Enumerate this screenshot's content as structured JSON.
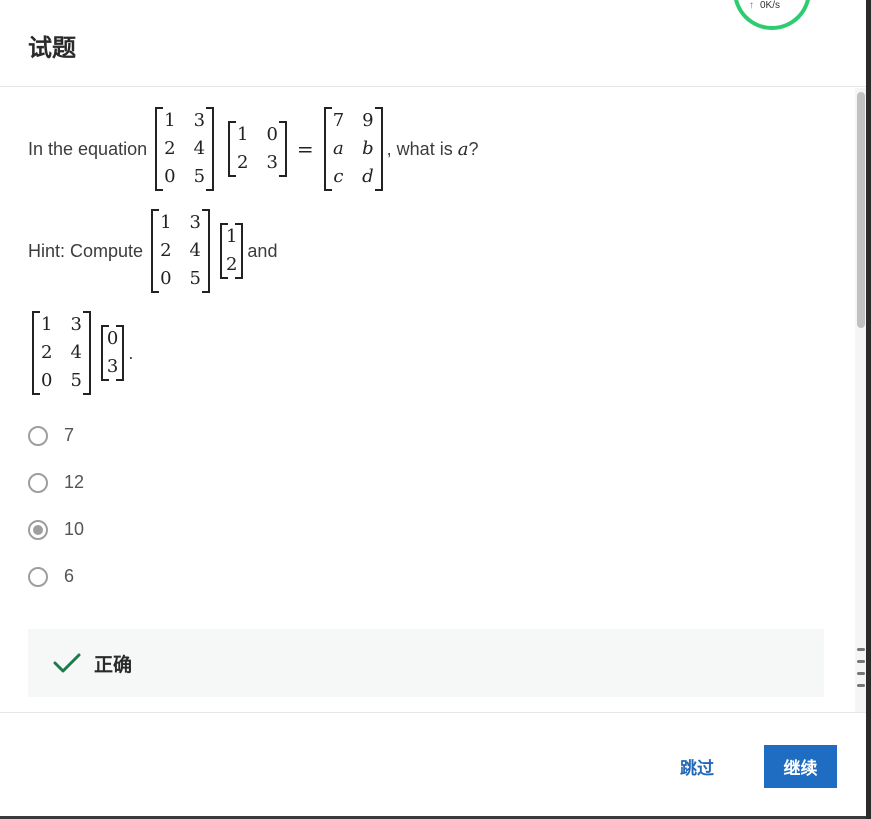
{
  "header": {
    "title": "试题"
  },
  "speed_widget": {
    "text": "0K/s"
  },
  "question": {
    "prefix": "In the equation",
    "suffix_before_var": ", what is ",
    "variable": "a",
    "suffix_after_var": "?",
    "matrix_a": [
      [
        "1",
        "3"
      ],
      [
        "2",
        "4"
      ],
      [
        "0",
        "5"
      ]
    ],
    "matrix_b": [
      [
        "1",
        "0"
      ],
      [
        "2",
        "3"
      ]
    ],
    "matrix_result": [
      [
        "7",
        "9"
      ],
      [
        "a",
        "b"
      ],
      [
        "c",
        "d"
      ]
    ],
    "equals": "="
  },
  "hint": {
    "prefix": "Hint: Compute",
    "conjunction": "and",
    "vector1": [
      [
        "1"
      ],
      [
        "2"
      ]
    ],
    "vector2": [
      [
        "0"
      ],
      [
        "3"
      ]
    ],
    "end": "."
  },
  "options": [
    {
      "label": "7",
      "selected": false
    },
    {
      "label": "12",
      "selected": false
    },
    {
      "label": "10",
      "selected": true
    },
    {
      "label": "6",
      "selected": false
    }
  ],
  "feedback": {
    "text": "正确",
    "color": "#1e7a4a"
  },
  "footer": {
    "skip_label": "跳过",
    "continue_label": "继续"
  },
  "colors": {
    "accent": "#1f6dc2",
    "link": "#2268b8",
    "success": "#2ecc71"
  }
}
